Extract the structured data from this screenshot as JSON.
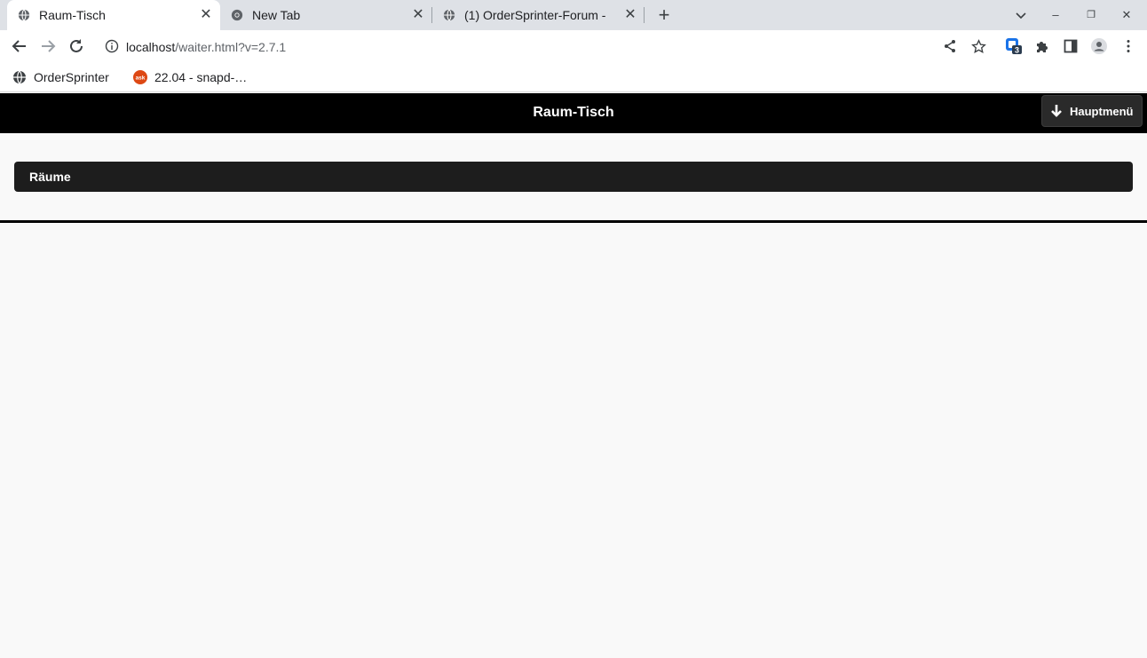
{
  "browser": {
    "tabs": [
      {
        "title": "Raum-Tisch",
        "close": "✕"
      },
      {
        "title": "New Tab",
        "close": "✕"
      },
      {
        "title": "(1) OrderSprinter-Forum -",
        "close": "✕"
      }
    ],
    "new_tab": "+",
    "window": {
      "minimize": "–",
      "restore": "❐",
      "close": "✕"
    },
    "url_host": "localhost",
    "url_path": "/waiter.html?v=2.7.1",
    "extension_badge": "3",
    "bookmarks": [
      {
        "label": "OrderSprinter",
        "icon": "globe-icon"
      },
      {
        "label": "22.04 - snapd-…",
        "icon": "ask-icon",
        "icon_text": "ask"
      }
    ]
  },
  "page": {
    "title": "Raum-Tisch",
    "main_menu_label": "Hauptmenü",
    "rooms_label": "Räume"
  },
  "colors": {
    "header_bg": "#000000",
    "bar_bg": "#1d1d1d",
    "page_bg": "#f9f9f9",
    "tabstrip_bg": "#dee1e6",
    "extension_blue": "#1a73e8"
  }
}
